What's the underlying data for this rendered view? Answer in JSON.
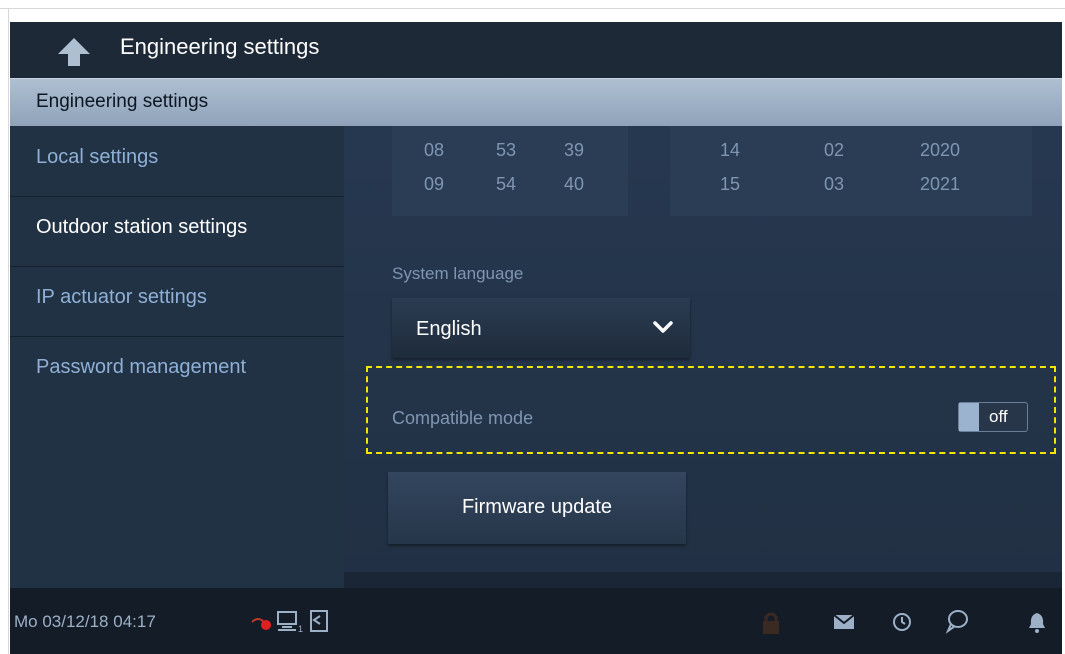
{
  "header": {
    "title": "Engineering settings",
    "back_icon": "back-arrow-icon"
  },
  "section": {
    "title": "Engineering settings"
  },
  "sidebar": {
    "items": [
      {
        "label": "Local settings",
        "color": "#8fb0d6"
      },
      {
        "label": "Outdoor station settings",
        "color": "#ffffff"
      },
      {
        "label": "IP actuator settings",
        "color": "#8fb0d6"
      },
      {
        "label": "Password management",
        "color": "#8fb0d6"
      }
    ]
  },
  "time_picker": {
    "hours": [
      "08",
      "09"
    ],
    "minutes": [
      "53",
      "54"
    ],
    "seconds": [
      "39",
      "40"
    ]
  },
  "date_picker": {
    "day": [
      "14",
      "15"
    ],
    "month": [
      "02",
      "03"
    ],
    "year": [
      "2020",
      "2021"
    ]
  },
  "language": {
    "label": "System language",
    "value": "English"
  },
  "compatible_mode": {
    "label": "Compatible mode",
    "state": "off"
  },
  "firmware": {
    "label": "Firmware update"
  },
  "status": {
    "datetime": "Mo 03/12/18  04:17",
    "icons": [
      "camera-off-icon",
      "network-icon",
      "door-icon",
      "lock-icon",
      "mail-icon",
      "history-icon",
      "chat-icon",
      "bell-icon"
    ]
  },
  "colors": {
    "accent": "#9bb3cf",
    "highlight": "#f2e600",
    "background": "#1e2a38"
  }
}
